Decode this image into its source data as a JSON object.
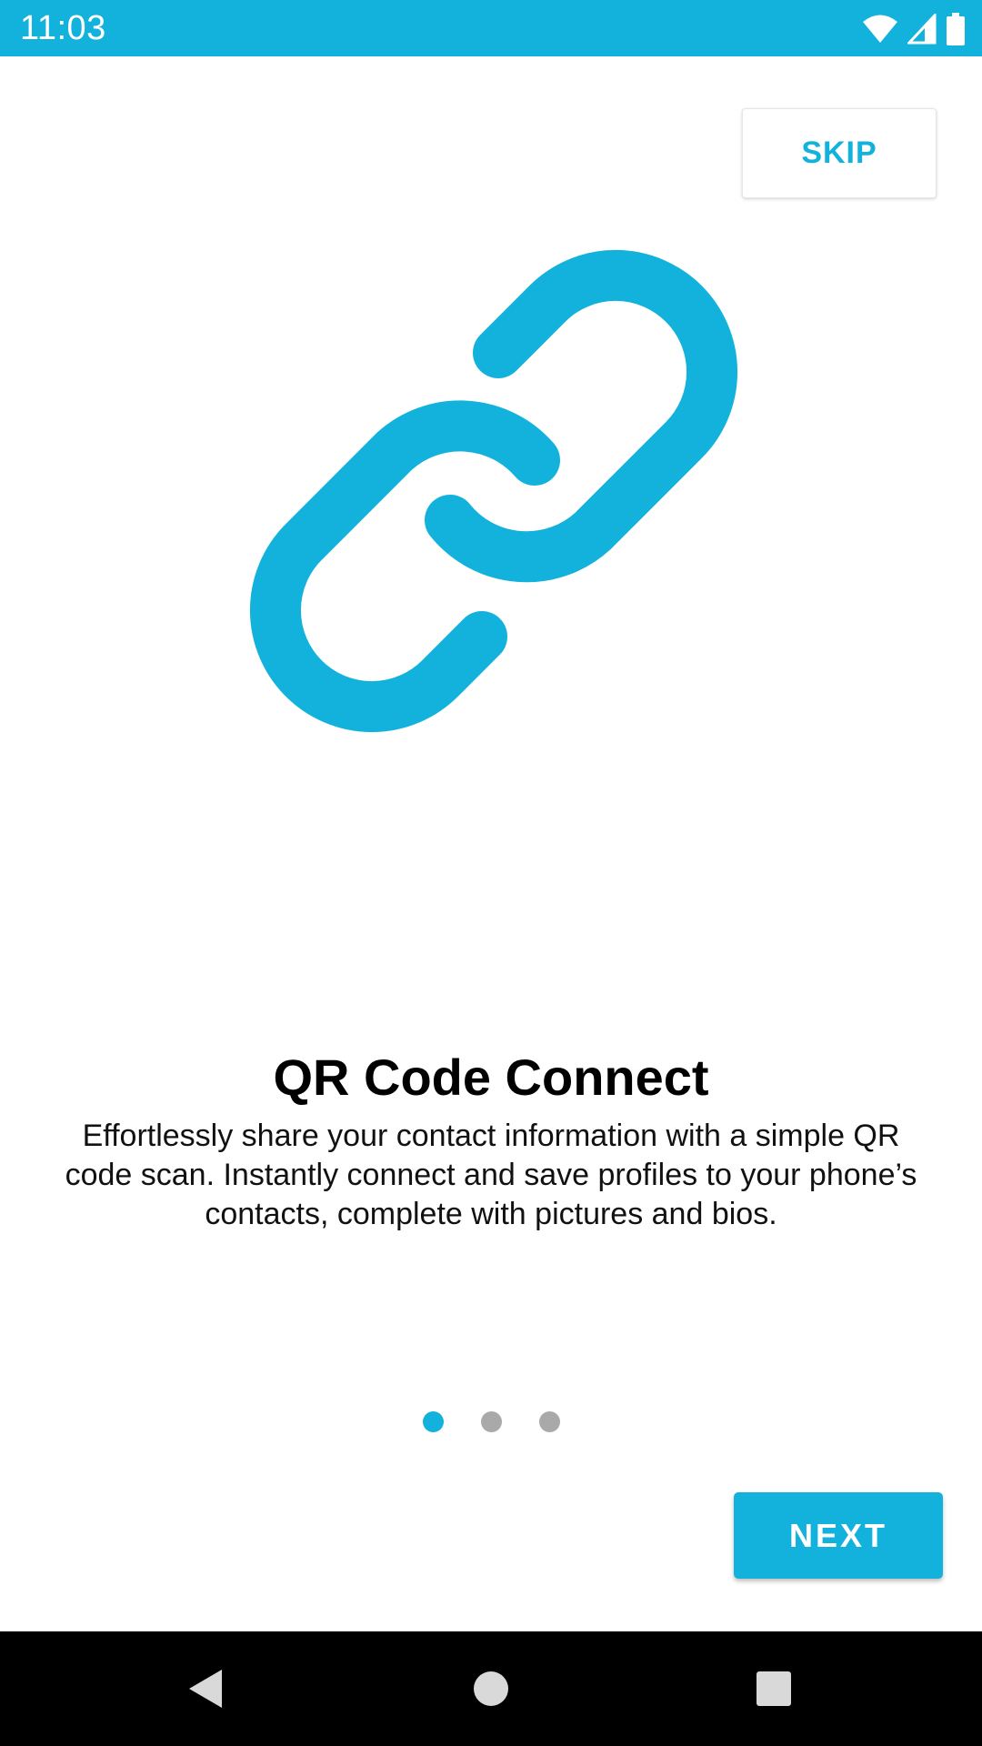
{
  "status_bar": {
    "time": "11:03",
    "icons": [
      "wifi-icon",
      "signal-icon",
      "battery-icon"
    ]
  },
  "skip_button": {
    "label": "SKIP"
  },
  "hero": {
    "icon": "link-icon"
  },
  "onboarding": {
    "title": "QR Code Connect",
    "description": "Effortlessly share your contact information with a simple QR code scan. Instantly connect and save profiles to your phone’s contacts, complete with pictures and bios.",
    "page_count": 3,
    "current_page": 1
  },
  "next_button": {
    "label": "NEXT"
  },
  "nav_bar": {
    "icons": [
      "back-icon",
      "home-icon",
      "recents-icon"
    ]
  },
  "colors": {
    "accent": "#13b2dc",
    "inactive_dot": "#a9a9a9",
    "nav_background": "#000000"
  }
}
